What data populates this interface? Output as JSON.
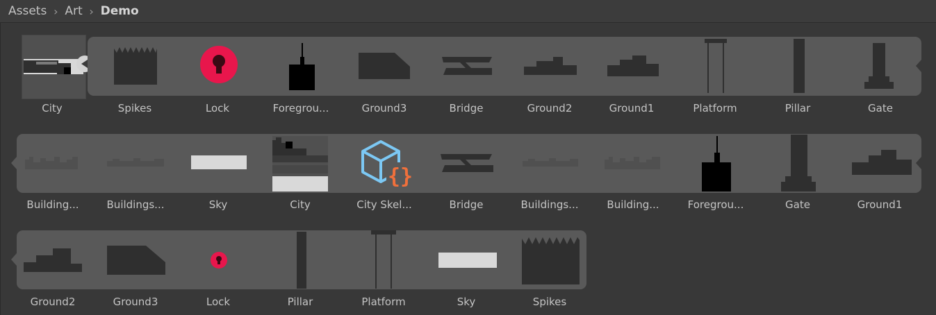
{
  "breadcrumb": {
    "items": [
      "Assets",
      "Art",
      "Demo"
    ],
    "separator": "›"
  },
  "row1": {
    "labels": [
      "City",
      "Spikes",
      "Lock",
      "Foregrou...",
      "Ground3",
      "Bridge",
      "Ground2",
      "Ground1",
      "Platform",
      "Pillar",
      "Gate"
    ]
  },
  "row2": {
    "labels": [
      "Building...",
      "Buildings...",
      "Sky",
      "City",
      "City Skel...",
      "Bridge",
      "Buildings...",
      "Building...",
      "Foregrou...",
      "Gate",
      "Ground1"
    ]
  },
  "row3": {
    "labels": [
      "Ground2",
      "Ground3",
      "Lock",
      "Pillar",
      "Platform",
      "Sky",
      "Spikes"
    ]
  },
  "colors": {
    "panel": "#383838",
    "strip": "#595959",
    "sprite_dark": "#2f2f2f",
    "lock_red": "#e8164c",
    "script_blue": "#7cc8f4",
    "script_orange": "#f0703c"
  },
  "icons": {
    "expand": "play-left-icon",
    "lock": "lock-icon",
    "script": "script-cube-icon"
  }
}
